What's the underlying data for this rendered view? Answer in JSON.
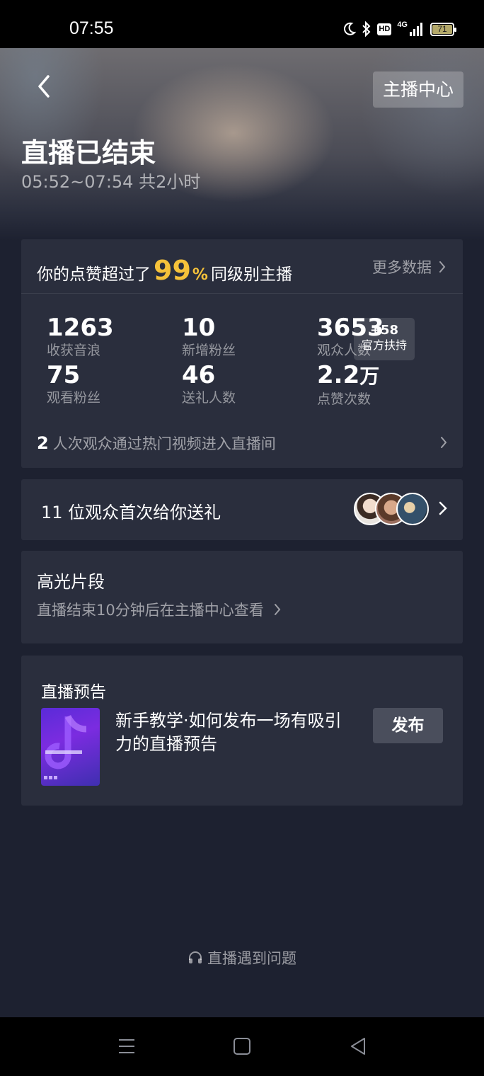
{
  "status_bar": {
    "time": "07:55",
    "network": "4G",
    "hd": "HD",
    "battery": "71"
  },
  "header": {
    "anchor_center_label": "主播中心",
    "title": "直播已结束",
    "time_range": "05:52~07:54 共2小时"
  },
  "likes": {
    "prefix": "你的点赞超过了",
    "percent": "99",
    "percent_sign": "%",
    "suffix": "同级别主播",
    "more_data": "更多数据"
  },
  "stats": [
    {
      "value": "1263",
      "label": "收获音浪"
    },
    {
      "value": "10",
      "label": "新增粉丝"
    },
    {
      "value": "3653",
      "label": "观众人数"
    },
    {
      "value": "75",
      "label": "观看粉丝"
    },
    {
      "value": "46",
      "label": "送礼人数"
    },
    {
      "value": "2.2",
      "unit": "万",
      "label": "点赞次数"
    }
  ],
  "official_support": {
    "value": "+58",
    "label": "官方扶持"
  },
  "hot_video": {
    "count": "2",
    "text": "人次观众通过热门视频进入直播间"
  },
  "first_gift": {
    "text": "11 位观众首次给你送礼"
  },
  "highlights": {
    "title": "高光片段",
    "subtitle": "直播结束10分钟后在主播中心查看"
  },
  "preview": {
    "title": "直播预告",
    "description": "新手教学·如何发布一场有吸引力的直播预告",
    "publish_label": "发布"
  },
  "help": {
    "label": "直播遇到问题"
  },
  "colors": {
    "background": "#1d2130",
    "card": "#2a2e3d",
    "accent": "#f6c23a"
  }
}
